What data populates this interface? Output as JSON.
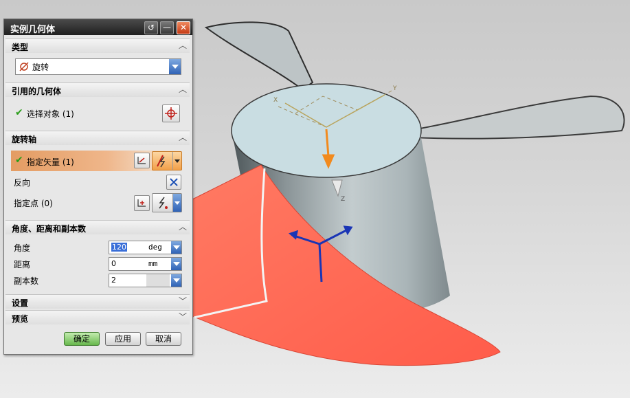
{
  "dialog": {
    "title": "实例几何体",
    "sections": {
      "type": "类型",
      "referenced_geometry": "引用的几何体",
      "rotation_axis": "旋转轴",
      "angle_distance_copies": "角度、距离和副本数",
      "settings": "设置",
      "preview": "预览"
    },
    "type_value": "旋转",
    "select_object": "选择对象 (1)",
    "specify_vector": "指定矢量 (1)",
    "reverse": "反向",
    "specify_point": "指定点 (0)",
    "angle_label": "角度",
    "angle_value": "120",
    "angle_unit": "deg",
    "distance_label": "距离",
    "distance_value": "0",
    "distance_unit": "mm",
    "copies_label": "副本数",
    "copies_value": "2",
    "ok": "确定",
    "apply": "应用",
    "cancel": "取消"
  },
  "viewport": {
    "axis_x": "X",
    "axis_y": "Y",
    "axis_z": "Z",
    "axis_z_bottom": "Z",
    "colors": {
      "hub": "#b9c3c6",
      "hub_top": "#c9dde2",
      "blade_selected": "#ff6a57",
      "vector_arrow": "#f28a1d",
      "triad": "#1a35b5"
    }
  }
}
